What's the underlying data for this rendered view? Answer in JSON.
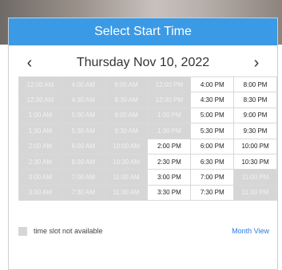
{
  "header": {
    "title": "Select Start Time"
  },
  "nav": {
    "prev_icon": "‹",
    "date": "Thursday Nov 10, 2022",
    "next_icon": "›"
  },
  "grid": {
    "columns": [
      [
        "12:00 AM",
        "12:30 AM",
        "1:00 AM",
        "1:30 AM",
        "2:00 AM",
        "2:30 AM",
        "3:00 AM",
        "3:30 AM"
      ],
      [
        "4:00 AM",
        "4:30 AM",
        "5:00 AM",
        "5:30 AM",
        "6:00 AM",
        "6:30 AM",
        "7:00 AM",
        "7:30 AM"
      ],
      [
        "8:00 AM",
        "8:30 AM",
        "9:00 AM",
        "9:30 AM",
        "10:00 AM",
        "10:30 AM",
        "11:00 AM",
        "11:30 AM"
      ],
      [
        "12:00 PM",
        "12:30 PM",
        "1:00 PM",
        "1:30 PM",
        "2:00 PM",
        "2:30 PM",
        "3:00 PM",
        "3:30 PM"
      ],
      [
        "4:00 PM",
        "4:30 PM",
        "5:00 PM",
        "5:30 PM",
        "6:00 PM",
        "6:30 PM",
        "7:00 PM",
        "7:30 PM"
      ],
      [
        "8:00 PM",
        "8:30 PM",
        "9:00 PM",
        "9:30 PM",
        "10:00 PM",
        "10:30 PM",
        "11:00 PM",
        "11:30 PM"
      ]
    ],
    "unavailable": [
      "12:00 AM",
      "12:30 AM",
      "1:00 AM",
      "1:30 AM",
      "2:00 AM",
      "2:30 AM",
      "3:00 AM",
      "3:30 AM",
      "4:00 AM",
      "4:30 AM",
      "5:00 AM",
      "5:30 AM",
      "6:00 AM",
      "6:30 AM",
      "7:00 AM",
      "7:30 AM",
      "8:00 AM",
      "8:30 AM",
      "9:00 AM",
      "9:30 AM",
      "10:00 AM",
      "10:30 AM",
      "11:00 AM",
      "11:30 AM",
      "12:00 PM",
      "12:30 PM",
      "1:00 PM",
      "1:30 PM",
      "11:00 PM",
      "11:30 PM"
    ]
  },
  "legend": {
    "not_available_text": "time slot not available",
    "month_view": "Month View"
  },
  "colors": {
    "header_bg": "#3b9ae6",
    "unavailable_bg": "#d6d6d6",
    "link": "#2a7be4"
  }
}
